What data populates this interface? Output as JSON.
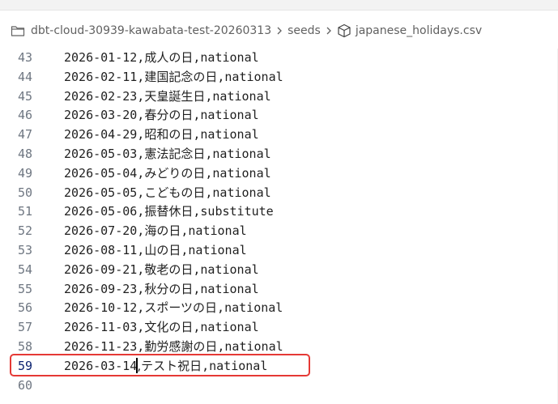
{
  "breadcrumb": {
    "items": [
      {
        "label": "dbt-cloud-30939-kawabata-test-20260313",
        "icon": "folder-icon"
      },
      {
        "label": "seeds",
        "icon": ""
      },
      {
        "label": "japanese_holidays.csv",
        "icon": "cube-icon"
      }
    ],
    "separator_icon": "chevron-right-icon"
  },
  "editor": {
    "active_line": "59",
    "lines": [
      {
        "num": "43",
        "date": "2026-01-12,",
        "name": "成人の日",
        "type": ",national"
      },
      {
        "num": "44",
        "date": "2026-02-11,",
        "name": "建国記念の日",
        "type": ",national"
      },
      {
        "num": "45",
        "date": "2026-02-23,",
        "name": "天皇誕生日",
        "type": ",national"
      },
      {
        "num": "46",
        "date": "2026-03-20,",
        "name": "春分の日",
        "type": ",national"
      },
      {
        "num": "47",
        "date": "2026-04-29,",
        "name": "昭和の日",
        "type": ",national"
      },
      {
        "num": "48",
        "date": "2026-05-03,",
        "name": "憲法記念日",
        "type": ",national"
      },
      {
        "num": "49",
        "date": "2026-05-04,",
        "name": "みどりの日",
        "type": ",national"
      },
      {
        "num": "50",
        "date": "2026-05-05,",
        "name": "こどもの日",
        "type": ",national"
      },
      {
        "num": "51",
        "date": "2026-05-06,",
        "name": "振替休日",
        "type": ",substitute"
      },
      {
        "num": "52",
        "date": "2026-07-20,",
        "name": "海の日",
        "type": ",national"
      },
      {
        "num": "53",
        "date": "2026-08-11,",
        "name": "山の日",
        "type": ",national"
      },
      {
        "num": "54",
        "date": "2026-09-21,",
        "name": "敬老の日",
        "type": ",national"
      },
      {
        "num": "55",
        "date": "2026-09-23,",
        "name": "秋分の日",
        "type": ",national"
      },
      {
        "num": "56",
        "date": "2026-10-12,",
        "name": "スポーツの日",
        "type": ",national"
      },
      {
        "num": "57",
        "date": "2026-11-03,",
        "name": "文化の日",
        "type": ",national"
      },
      {
        "num": "58",
        "date": "2026-11-23,",
        "name": "勤労感謝の日",
        "type": ",national"
      },
      {
        "num": "59",
        "date": "2026-03-14",
        "name": ",テスト祝日",
        "type": ",national"
      },
      {
        "num": "60",
        "date": "",
        "name": "",
        "type": ""
      }
    ]
  },
  "colors": {
    "highlight_border": "#e53935",
    "line_number": "#6e7681",
    "active_line_number": "#0b216f",
    "code_text": "#1f1f1f"
  }
}
